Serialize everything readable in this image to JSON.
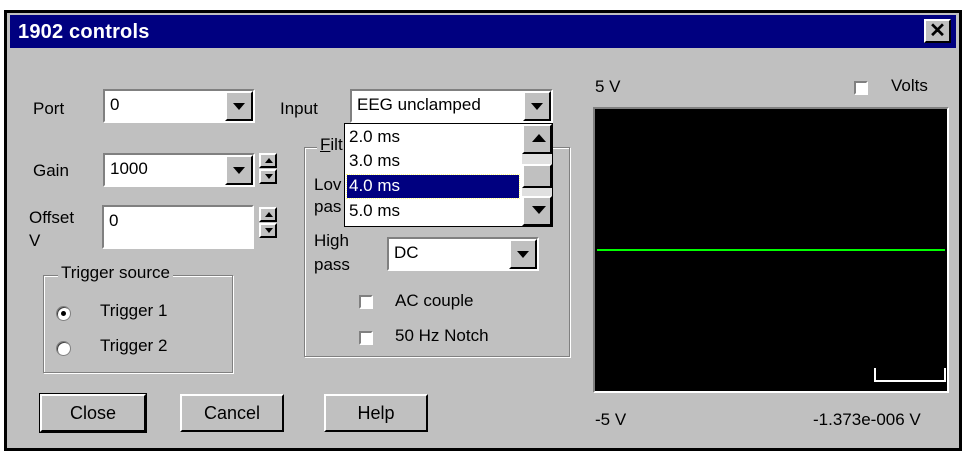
{
  "window": {
    "title": "1902 controls"
  },
  "port": {
    "label": "Port",
    "value": "0"
  },
  "input": {
    "label": "Input",
    "value": "EEG unclamped"
  },
  "gain": {
    "label": "Gain",
    "value": "1000"
  },
  "offset": {
    "label_line1": "Offset",
    "label_line2": "V",
    "value": "0"
  },
  "trigger": {
    "title": "Trigger source",
    "options": [
      "Trigger 1",
      "Trigger 2"
    ],
    "selected": "Trigger 1"
  },
  "filter": {
    "title_partial": "Filt",
    "title_underline": "F",
    "low_label_line1": "Lov",
    "low_label_line2": "pas",
    "high_label_line1": "High",
    "high_label_line2": "pass",
    "high_value": "DC",
    "ac_couple_label": "AC couple",
    "notch_label": "50 Hz Notch",
    "ac_couple_checked": false,
    "notch_checked": false
  },
  "dropdown_list": {
    "items": [
      "2.0 ms",
      "3.0 ms",
      "4.0 ms",
      "5.0 ms"
    ],
    "selected": "4.0 ms"
  },
  "buttons": {
    "close": "Close",
    "cancel": "Cancel",
    "help": "Help"
  },
  "scope": {
    "top_label": "5 V",
    "bottom_label": "-5 V",
    "readout": "-1.373e-006 V",
    "volts_label": "Volts",
    "volts_checked": false,
    "trace_color": "#00ff00",
    "background": "#000000",
    "trace_level_fraction": 0.5
  },
  "colors": {
    "face": "#c0c0c0",
    "titlebar": "#000080",
    "selection": "#000080"
  }
}
